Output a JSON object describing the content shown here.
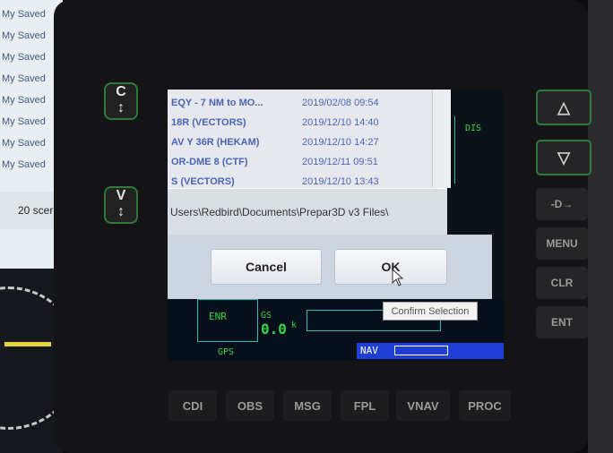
{
  "left_monitor": {
    "files": [
      "My Saved",
      "My Saved",
      "My Saved",
      "My Saved",
      "My Saved",
      "My Saved",
      "My Saved",
      "My Saved"
    ],
    "status": "20 scer"
  },
  "gps_unit": {
    "left_knobs": [
      {
        "label": "C"
      },
      {
        "label": "V"
      }
    ],
    "right_keys": [
      {
        "label": "△",
        "name": "up-arrow-key"
      },
      {
        "label": "▽",
        "name": "down-arrow-key"
      },
      {
        "label": "-D→",
        "name": "direct-to-key"
      },
      {
        "label": "MENU",
        "name": "menu-key"
      },
      {
        "label": "CLR",
        "name": "clr-key"
      },
      {
        "label": "ENT",
        "name": "ent-key"
      }
    ],
    "soft_keys": [
      "CDI",
      "OBS",
      "MSG",
      "FPL",
      "VNAV",
      "PROC"
    ]
  },
  "dialog": {
    "files": [
      {
        "name": "EQY - 7 NM to MO...",
        "date": "2019/02/08 09:54"
      },
      {
        "name": "18R (VECTORS)",
        "date": "2019/12/10 14:40"
      },
      {
        "name": "AV Y 36R (HEKAM)",
        "date": "2019/12/10 14:27"
      },
      {
        "name": "OR-DME 8 (CTF)",
        "date": "2019/12/11 09:51"
      },
      {
        "name": "S (VECTORS)",
        "date": "2019/12/10 13:43"
      }
    ],
    "path": "Users\\Redbird\\Documents\\Prepar3D v3 Files\\",
    "cancel_label": "Cancel",
    "ok_label": "OK",
    "tooltip": "Confirm Selection"
  },
  "gps_screen": {
    "dis_label": "DIS",
    "enr_label": "ENR",
    "gps_label": "GPS",
    "gs_label": "GS",
    "gs_value": "0.0",
    "gs_unit": "k",
    "nav_label": "NAV"
  },
  "colors": {
    "screen_green": "#35d548",
    "cell_cyan": "#2db9b0",
    "nav_blue": "#1f3fd4",
    "knob_green": "#2e7a3a"
  }
}
